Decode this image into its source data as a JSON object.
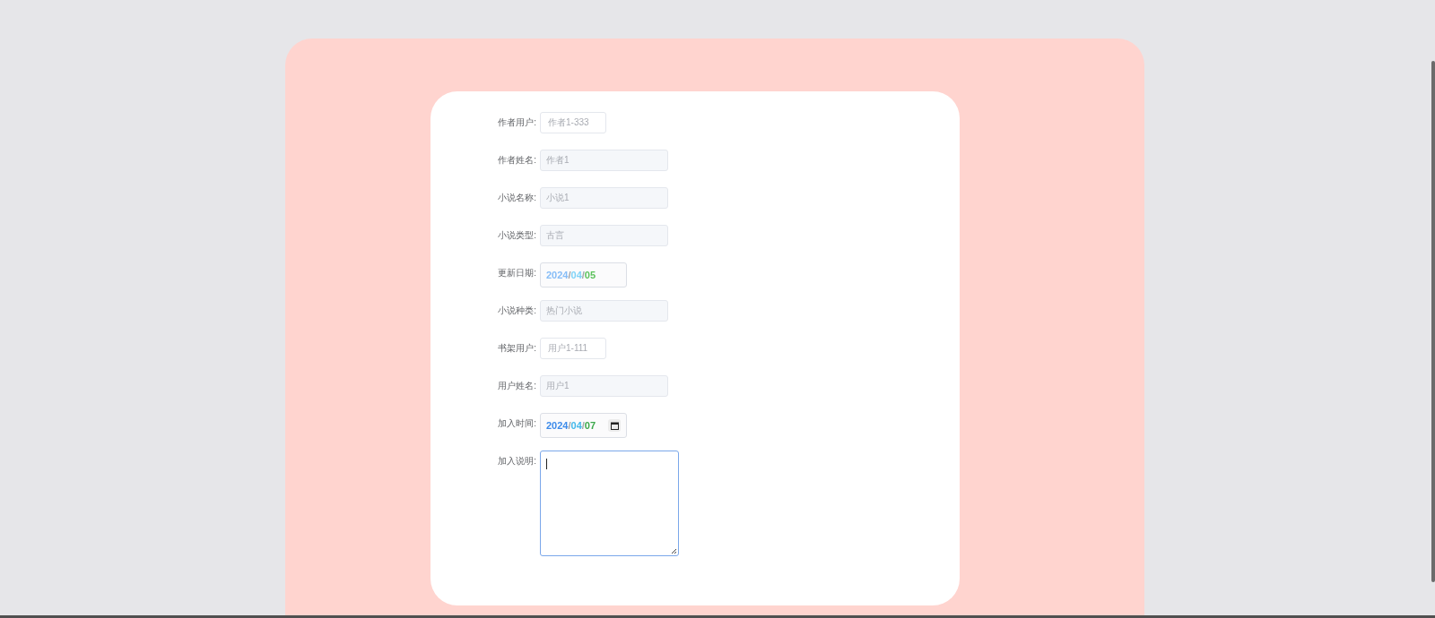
{
  "form": {
    "fields": [
      {
        "label": "作者用户:",
        "kind": "narrow",
        "value": "作者1-333"
      },
      {
        "label": "作者姓名:",
        "kind": "wide",
        "value": "作者1"
      },
      {
        "label": "小说名称:",
        "kind": "wide",
        "value": "小说1"
      },
      {
        "label": "小说类型:",
        "kind": "wide",
        "value": "古言"
      },
      {
        "label": "更新日期:",
        "kind": "date",
        "calendar": false,
        "parts": [
          {
            "text": "2024",
            "color": "#86bdf7"
          },
          {
            "text": "/"
          },
          {
            "text": "04",
            "color": "#7fd3f7"
          },
          {
            "text": "/"
          },
          {
            "text": "05",
            "color": "#5cc25c"
          }
        ]
      },
      {
        "label": "小说种类:",
        "kind": "wide",
        "value": "热门小说"
      },
      {
        "label": "书架用户:",
        "kind": "narrow",
        "value": "用户1-111"
      },
      {
        "label": "用户姓名:",
        "kind": "wide",
        "value": "用户1"
      },
      {
        "label": "加入时间:",
        "kind": "date",
        "calendar": true,
        "parts": [
          {
            "text": "2024",
            "color": "#3d8bea"
          },
          {
            "text": "/"
          },
          {
            "text": "04",
            "color": "#43b8ea"
          },
          {
            "text": "/"
          },
          {
            "text": "07",
            "color": "#3aa84a"
          }
        ]
      },
      {
        "label": "加入说明:",
        "kind": "textarea",
        "focused": true
      }
    ]
  }
}
